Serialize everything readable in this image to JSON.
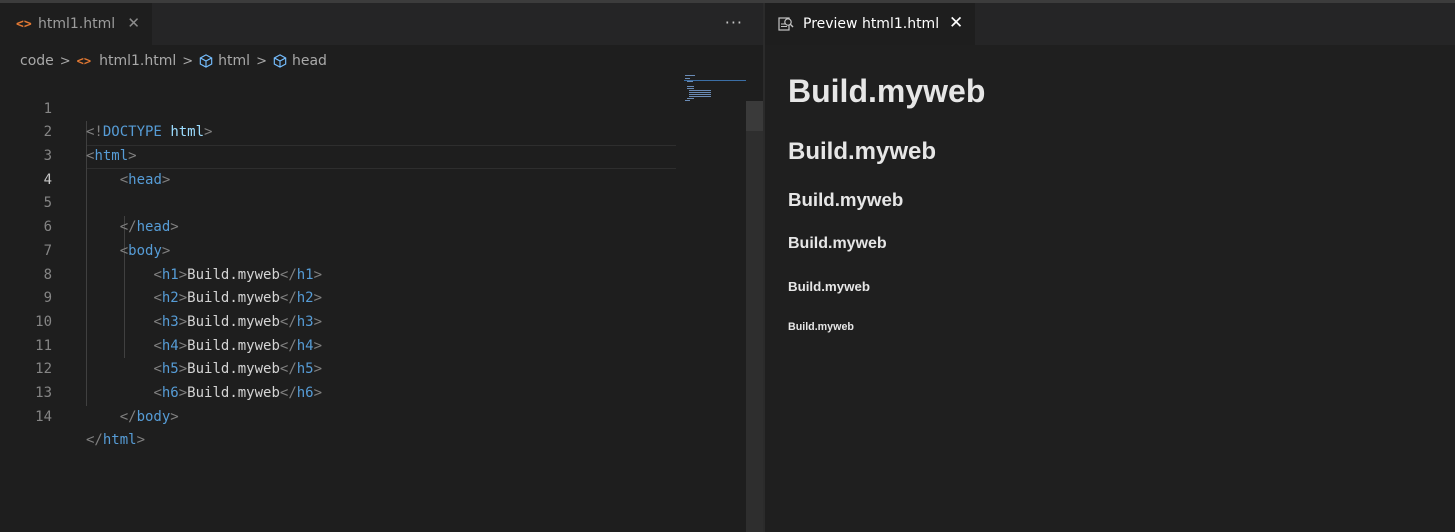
{
  "editor": {
    "tab": {
      "icon": "html-file-icon",
      "label": "html1.html"
    },
    "more_label": "···",
    "breadcrumb": [
      "code",
      "html1.html",
      "html",
      "head"
    ],
    "code_lines": [
      {
        "n": "1",
        "active": false
      },
      {
        "n": "2",
        "active": false
      },
      {
        "n": "3",
        "active": false
      },
      {
        "n": "4",
        "active": true
      },
      {
        "n": "5",
        "active": false
      },
      {
        "n": "6",
        "active": false
      },
      {
        "n": "7",
        "active": false
      },
      {
        "n": "8",
        "active": false
      },
      {
        "n": "9",
        "active": false
      },
      {
        "n": "10",
        "active": false
      },
      {
        "n": "11",
        "active": false
      },
      {
        "n": "12",
        "active": false
      },
      {
        "n": "13",
        "active": false
      },
      {
        "n": "14",
        "active": false
      }
    ],
    "code": {
      "l1_doctype": "<!DOCTYPE",
      "l1_html": "html",
      "l1_close": ">",
      "heading_text": "Build.myweb"
    }
  },
  "preview": {
    "tab_label": "Preview html1.html",
    "headings": [
      "Build.myweb",
      "Build.myweb",
      "Build.myweb",
      "Build.myweb",
      "Build.myweb",
      "Build.myweb"
    ]
  },
  "colors": {
    "background": "#1e1e1e",
    "tag": "#569cd6",
    "bracket": "#808080",
    "text": "#d4d4d4",
    "html_icon": "#e37933"
  }
}
